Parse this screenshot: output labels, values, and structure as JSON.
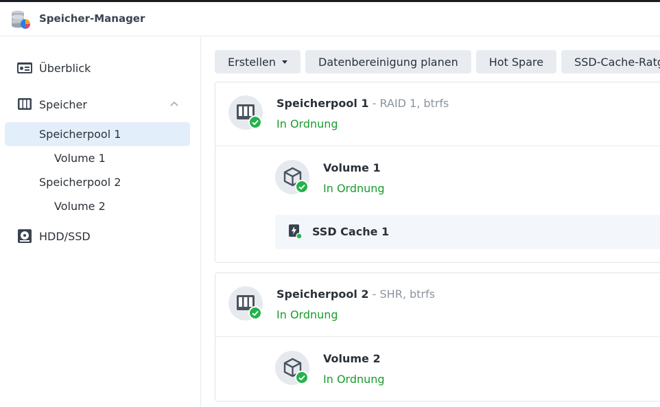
{
  "app": {
    "title": "Speicher-Manager"
  },
  "sidebar": {
    "overview": "Überblick",
    "storage": "Speicher",
    "pool1": "Speicherpool 1",
    "volume1": "Volume 1",
    "pool2": "Speicherpool 2",
    "volume2": "Volume 2",
    "hdd": "HDD/SSD"
  },
  "toolbar": {
    "create": "Erstellen",
    "scrub": "Datenbereinigung planen",
    "hotspare": "Hot Spare",
    "ssdcache": "SSD-Cache-Ratgeber"
  },
  "pools": [
    {
      "name": "Speicherpool 1",
      "meta": " - RAID 1, btrfs",
      "status": "In Ordnung",
      "volume": {
        "name": "Volume 1",
        "status": "In Ordnung"
      },
      "cache": "SSD Cache 1"
    },
    {
      "name": "Speicherpool 2",
      "meta": " - SHR, btrfs",
      "status": "In Ordnung",
      "volume": {
        "name": "Volume 2",
        "status": "In Ordnung"
      }
    }
  ],
  "colors": {
    "ok": "#1a9c2c",
    "check": "#24b34b",
    "selected": "#e3eefb"
  }
}
